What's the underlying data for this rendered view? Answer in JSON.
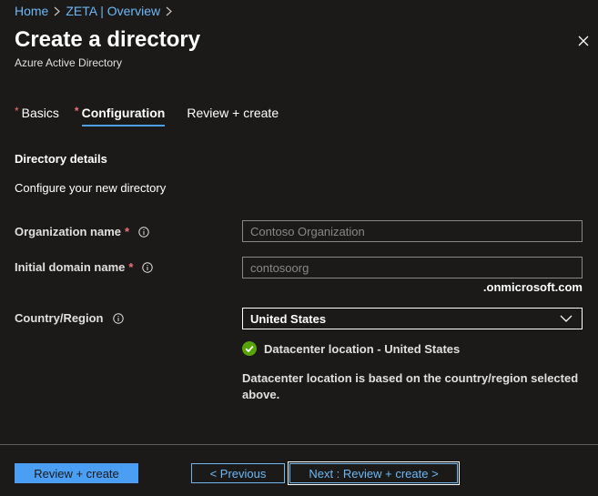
{
  "breadcrumb": {
    "items": [
      "Home",
      "ZETA | Overview"
    ]
  },
  "header": {
    "title": "Create a directory",
    "subtitle": "Azure Active Directory"
  },
  "tabs": [
    {
      "label": "Basics",
      "required": "*"
    },
    {
      "label": "Configuration",
      "required": "*"
    },
    {
      "label": "Review + create"
    }
  ],
  "section": {
    "heading": "Directory details",
    "description": "Configure your new directory"
  },
  "form": {
    "org_name": {
      "label": "Organization name",
      "required": "*",
      "placeholder": "Contoso Organization",
      "value": ""
    },
    "domain": {
      "label": "Initial domain name",
      "required": "*",
      "placeholder": "contosoorg",
      "value": "",
      "suffix": ".onmicrosoft.com"
    },
    "country": {
      "label": "Country/Region",
      "selected": "United States"
    }
  },
  "status": {
    "text": "Datacenter location - United States",
    "color": "#57a300"
  },
  "note": "Datacenter location is based on the country/region selected above.",
  "footer": {
    "review_label": "Review + create",
    "previous_label": "< Previous",
    "next_label": "Next : Review + create >"
  },
  "colors": {
    "accent": "#4a9ff5",
    "link": "#6cb8f6",
    "required": "#f1707b",
    "background": "#1b1a19"
  }
}
